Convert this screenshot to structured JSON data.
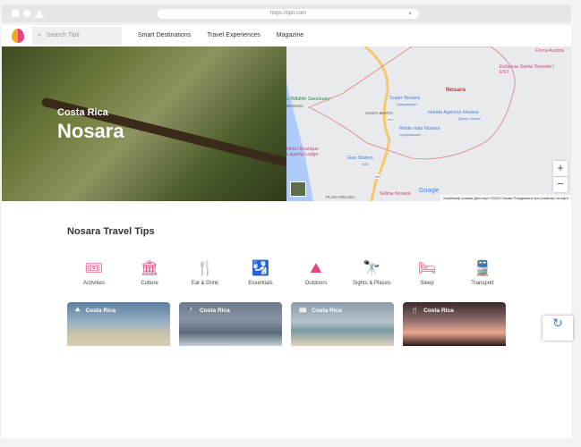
{
  "browser": {
    "url": "https://tiplr.com"
  },
  "nav": {
    "search_placeholder": "Search Tiplr",
    "links": [
      "Smart Destinations",
      "Travel Experiences",
      "Magazine"
    ]
  },
  "hero": {
    "country": "Costa Rica",
    "city": "Nosara"
  },
  "map": {
    "labels": {
      "finca": "Finca Austria",
      "estancia": "Estancia Santa Teresita | EST",
      "nosara": "Nosara",
      "wildlife": "u Wildlife Sanctuary",
      "nosara_small": "NOSARA",
      "super": "Super Nosara",
      "super_sub": "Супермаркет",
      "santa_marta": "SANTA MARTA",
      "honda": "Honda Agencia Nosara",
      "honda_sub": "Дилер Honda",
      "rinde": "Rinde más Nosara",
      "rinde_sub": "Супермаркет",
      "hotel": "Hotel Boutique Lagarta Lodge",
      "gas": "Gas Station",
      "gas_sub": "АЗС",
      "selina": "Selina Nosara",
      "pelada": "PLAYA PELADA",
      "google": "Google",
      "road1": "160",
      "road2": "160"
    },
    "attribution": "Комбінації клавіш   Дані карт ©2023   Умови   Повідомити про помилку на карті",
    "zoom_in": "+",
    "zoom_out": "−"
  },
  "section_title": "Nosara Travel Tips",
  "categories": [
    {
      "label": "Activities",
      "icon": "🎟"
    },
    {
      "label": "Culture",
      "icon": "🏛"
    },
    {
      "label": "Eat & Drink",
      "icon": "🍴"
    },
    {
      "label": "Essentials",
      "icon": "🛂"
    },
    {
      "label": "Outdoors",
      "icon": "⛰"
    },
    {
      "label": "Sights & Places",
      "icon": "🔭"
    },
    {
      "label": "Sleep",
      "icon": "🛏"
    },
    {
      "label": "Transport",
      "icon": "🚆"
    }
  ],
  "cards": [
    {
      "title": "Costa Rica",
      "icon": "⛰"
    },
    {
      "title": "Costa Rica",
      "icon": "🔭"
    },
    {
      "title": "Costa Rica",
      "icon": "🎟"
    },
    {
      "title": "Costa Rica",
      "icon": "🍴"
    }
  ],
  "colors": {
    "accent": "#e0457f"
  }
}
